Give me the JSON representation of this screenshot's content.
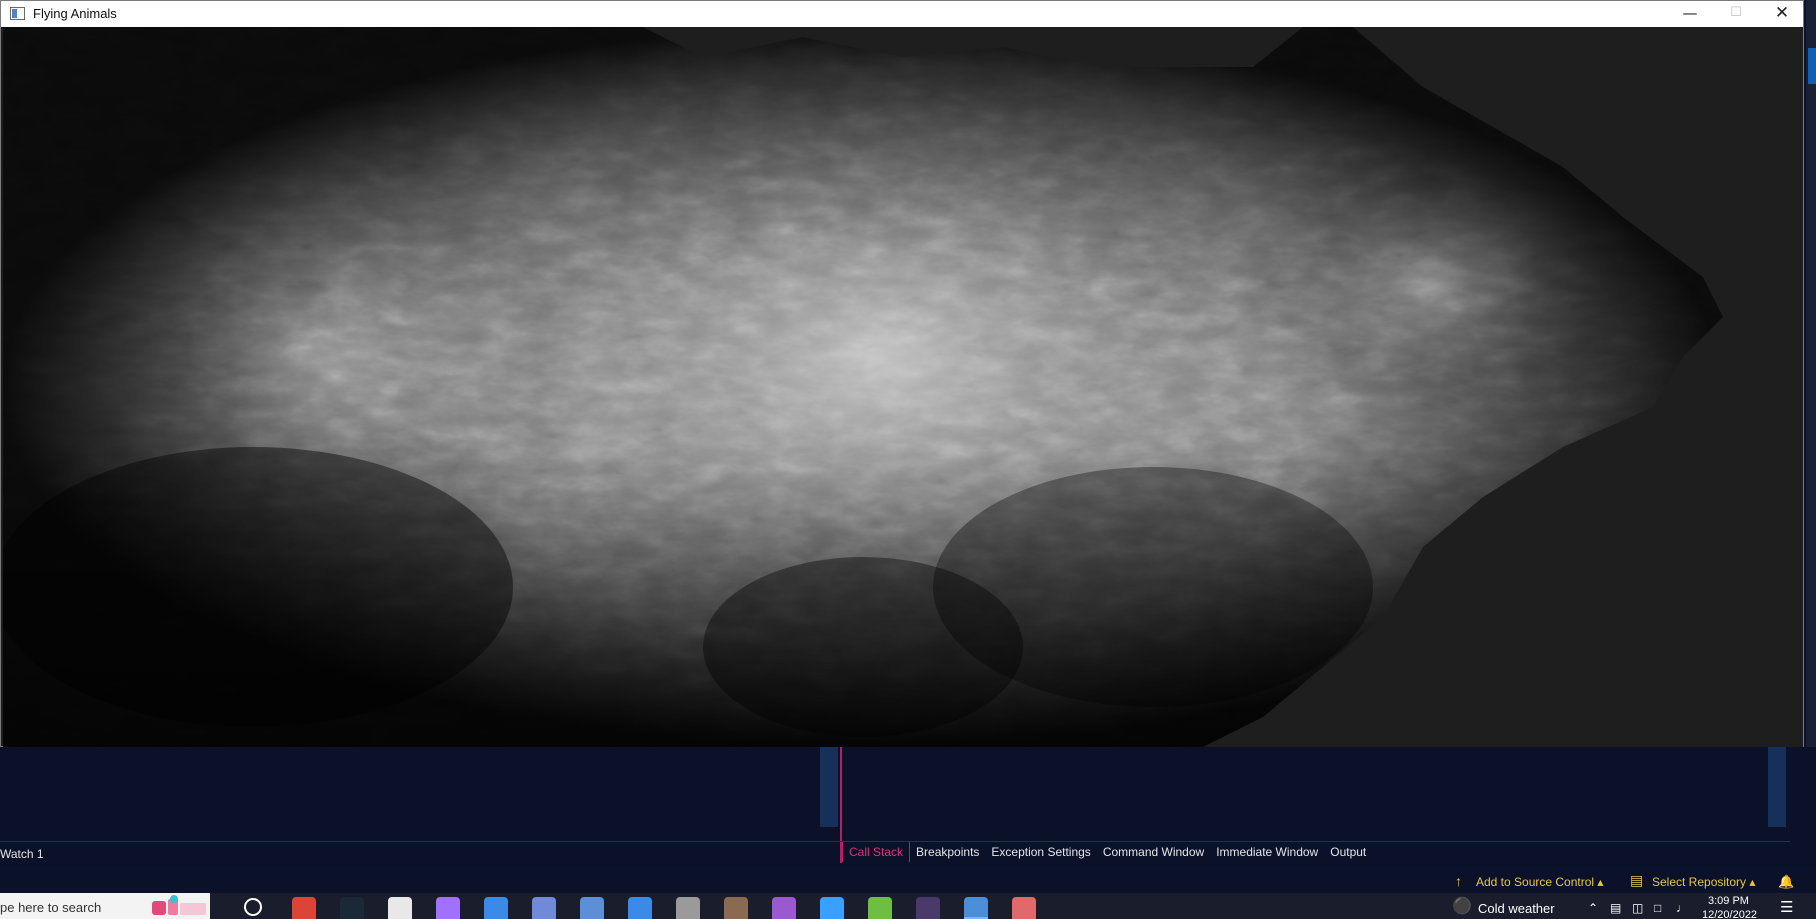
{
  "window": {
    "title": "Flying Animals",
    "minimize": "—",
    "maximize": "☐",
    "close": "✕"
  },
  "debug": {
    "watch_tab": "Watch 1",
    "tabs": [
      {
        "label": "Call Stack",
        "active": true
      },
      {
        "label": "Breakpoints",
        "active": false
      },
      {
        "label": "Exception Settings",
        "active": false
      },
      {
        "label": "Command Window",
        "active": false
      },
      {
        "label": "Immediate Window",
        "active": false
      },
      {
        "label": "Output",
        "active": false
      }
    ]
  },
  "status": {
    "add_to_source_control": "Add to Source Control ▴",
    "select_repository": "Select Repository ▴",
    "source_icon": "↑",
    "repo_icon": "▤",
    "notify_icon": "🔔"
  },
  "taskbar": {
    "search_placeholder": "pe here to search",
    "apps": [
      {
        "name": "chrome-icon",
        "color": "#dc4437"
      },
      {
        "name": "steam-icon",
        "color": "#1b2838"
      },
      {
        "name": "app-icon",
        "color": "#e8e8e8"
      },
      {
        "name": "obs-icon",
        "color": "#a070ff"
      },
      {
        "name": "mail-icon",
        "color": "#3c8ae8"
      },
      {
        "name": "discord-icon",
        "color": "#7289da"
      },
      {
        "name": "app-icon",
        "color": "#5c8fd8"
      },
      {
        "name": "store-icon",
        "color": "#3c8ae8"
      },
      {
        "name": "minecraft-icon",
        "color": "#9a9a9a"
      },
      {
        "name": "photo-icon",
        "color": "#8a6a50"
      },
      {
        "name": "visual-studio-icon",
        "color": "#9b59d0"
      },
      {
        "name": "app-icon",
        "color": "#3aa0ff"
      },
      {
        "name": "utorrent-icon",
        "color": "#6fbe44"
      },
      {
        "name": "terminal-icon",
        "color": "#4a3a6a"
      },
      {
        "name": "active-window-icon",
        "color": "#4a8fd8"
      },
      {
        "name": "paint-icon",
        "color": "#e06a6a"
      }
    ],
    "weather": "Cold weather",
    "clock_time": "3:09 PM",
    "clock_date": "12/20/2022",
    "action_center": "☰"
  },
  "colors": {
    "accent_pink": "#e0307d",
    "status_yellow": "#e6c84a",
    "vs_background": "#0a1129",
    "render_background": "#1e1e1e"
  }
}
